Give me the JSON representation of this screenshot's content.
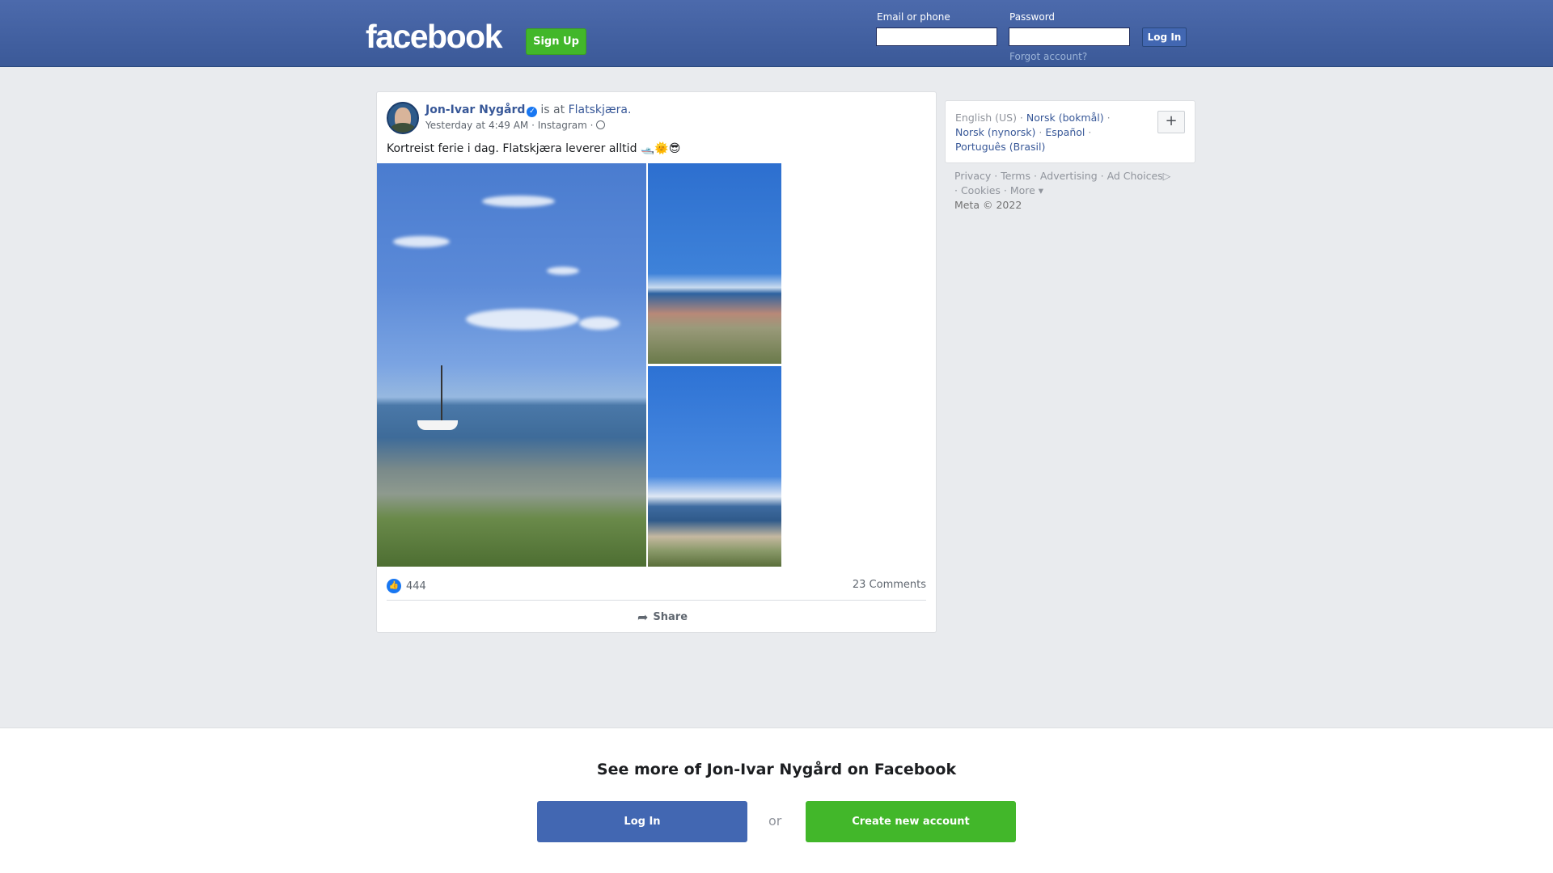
{
  "header": {
    "logo": "facebook",
    "signup_label": "Sign Up",
    "email_label": "Email or phone",
    "password_label": "Password",
    "login_label": "Log In",
    "forgot_label": "Forgot account?"
  },
  "post": {
    "author": "Jon-Ivar Nygård",
    "verified_icon": "✓",
    "is_at_text": "is at",
    "place": "Flatskjæra.",
    "time": "Yesterday at 4:49 AM",
    "sep": "·",
    "source": "Instagram",
    "text": "Kortreist ferie i dag. Flatskjæra leverer alltid 🛥️🌞😎",
    "likes": "444",
    "comments": "23 Comments",
    "share_label": "Share"
  },
  "languages": {
    "current": "English (US)",
    "items": [
      "Norsk (bokmål)",
      "Norsk (nynorsk)",
      "Español",
      "Português (Brasil)"
    ],
    "add_label": "+"
  },
  "footer": {
    "links": [
      "Privacy",
      "Terms",
      "Advertising",
      "Ad Choices",
      "Cookies",
      "More"
    ],
    "copyright": "Meta © 2022"
  },
  "banner": {
    "title": "See more of Jon-Ivar Nygård on Facebook",
    "login_label": "Log In",
    "or_label": "or",
    "create_label": "Create new account"
  },
  "colors": {
    "brand_blue": "#3b5998",
    "green": "#42b72a",
    "link": "#385898"
  }
}
